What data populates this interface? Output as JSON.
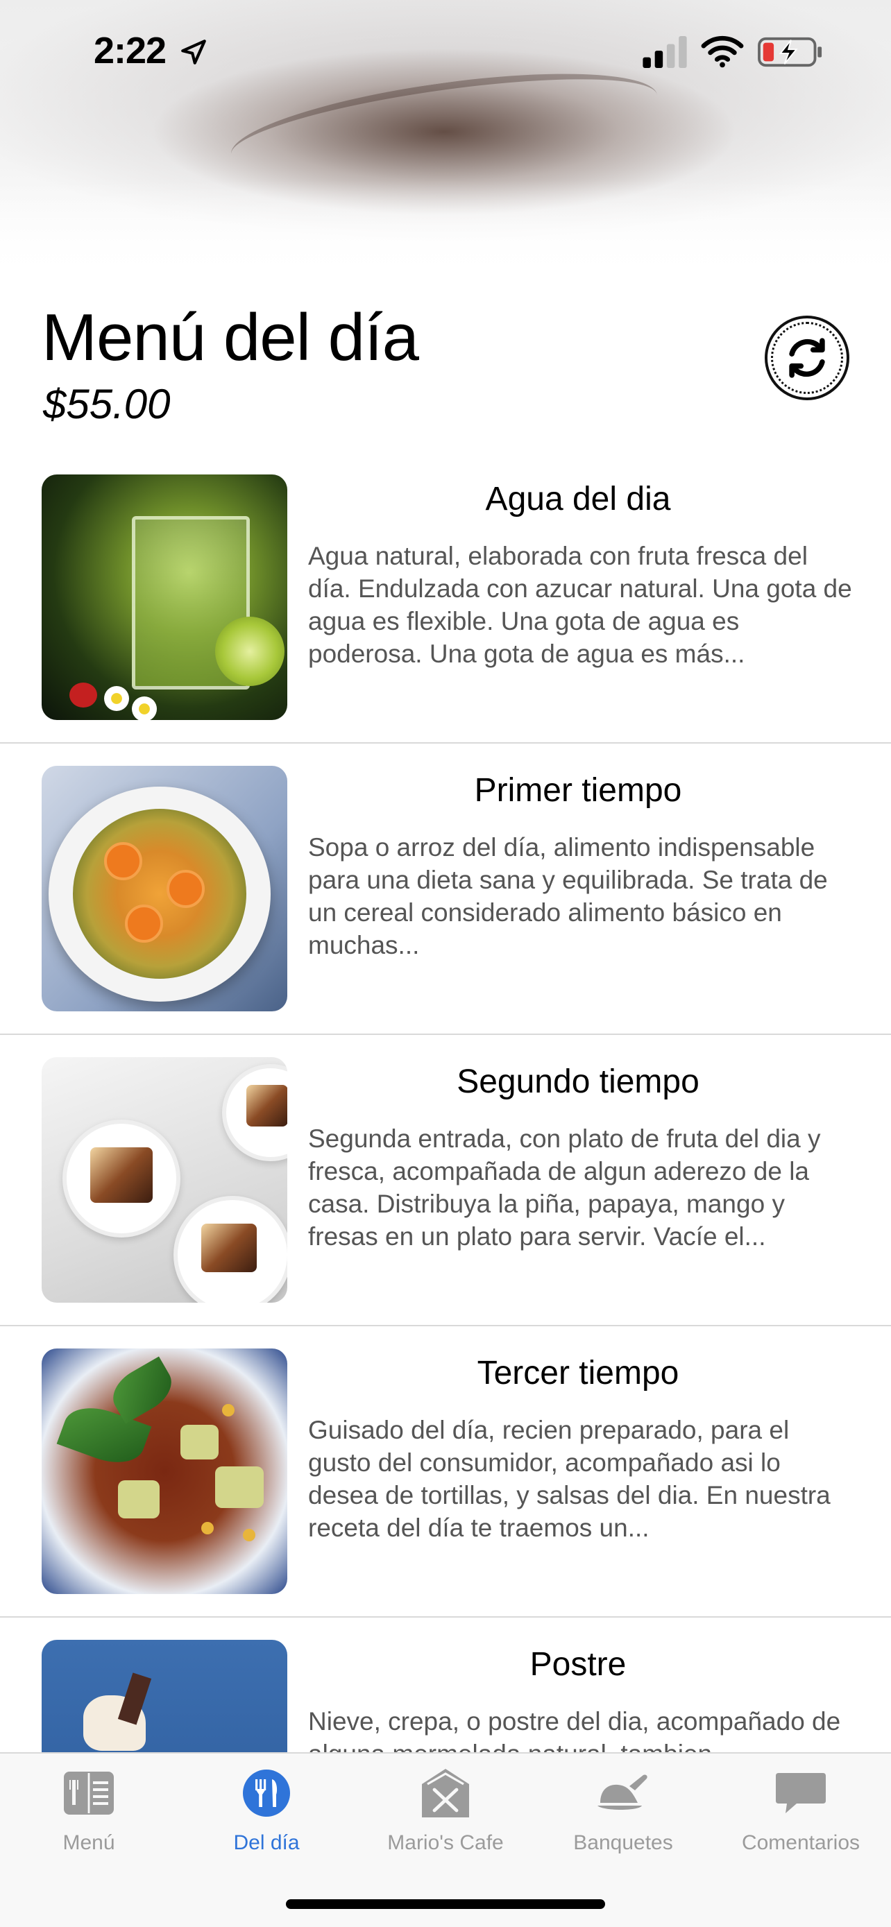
{
  "status_bar": {
    "time": "2:22"
  },
  "header": {
    "title": "Menú del día",
    "price": "$55.00"
  },
  "menu_items": [
    {
      "title": "Agua del dia",
      "description": "Agua natural, elaborada con fruta fresca del día. Endulzada con azucar natural. Una gota de agua es flexible. Una gota de agua es poderosa. Una gota de agua es más...",
      "image_icon": "lime-water-glass"
    },
    {
      "title": "Primer tiempo",
      "description": "Sopa o arroz del día, alimento indispensable para una dieta sana y equilibrada. Se trata de un cereal considerado alimento básico en muchas...",
      "image_icon": "soup-bowl"
    },
    {
      "title": "Segundo tiempo",
      "description": "Segunda entrada, con plato de fruta del dia y fresca, acompañada de algun aderezo de la casa.  Distribuya la piña, papaya, mango y fresas en un plato para servir. Vacíe el...",
      "image_icon": "dessert-plates"
    },
    {
      "title": "Tercer tiempo",
      "description": "Guisado del día, recien preparado, para el gusto del consumidor, acompañado asi lo desea de tortillas, y salsas del dia. En nuestra receta del día te traemos un...",
      "image_icon": "stew-plate"
    },
    {
      "title": "Postre",
      "description": "Nieve, crepa, o postre del dia, acompañado de alguna mermelada natural, tambien...",
      "image_icon": "ice-cream"
    }
  ],
  "tabs": [
    {
      "label": "Menú",
      "icon": "menu-book-icon",
      "active": false
    },
    {
      "label": "Del día",
      "icon": "fork-knife-icon",
      "active": true
    },
    {
      "label": "Mario's Cafe",
      "icon": "restaurant-house-icon",
      "active": false
    },
    {
      "label": "Banquetes",
      "icon": "serving-dish-icon",
      "active": false
    },
    {
      "label": "Comentarios",
      "icon": "chat-bubble-icon",
      "active": false
    }
  ],
  "colors": {
    "accent": "#2f74d9",
    "inactive_tab": "#9b9b9b",
    "battery_low": "#e53935"
  }
}
